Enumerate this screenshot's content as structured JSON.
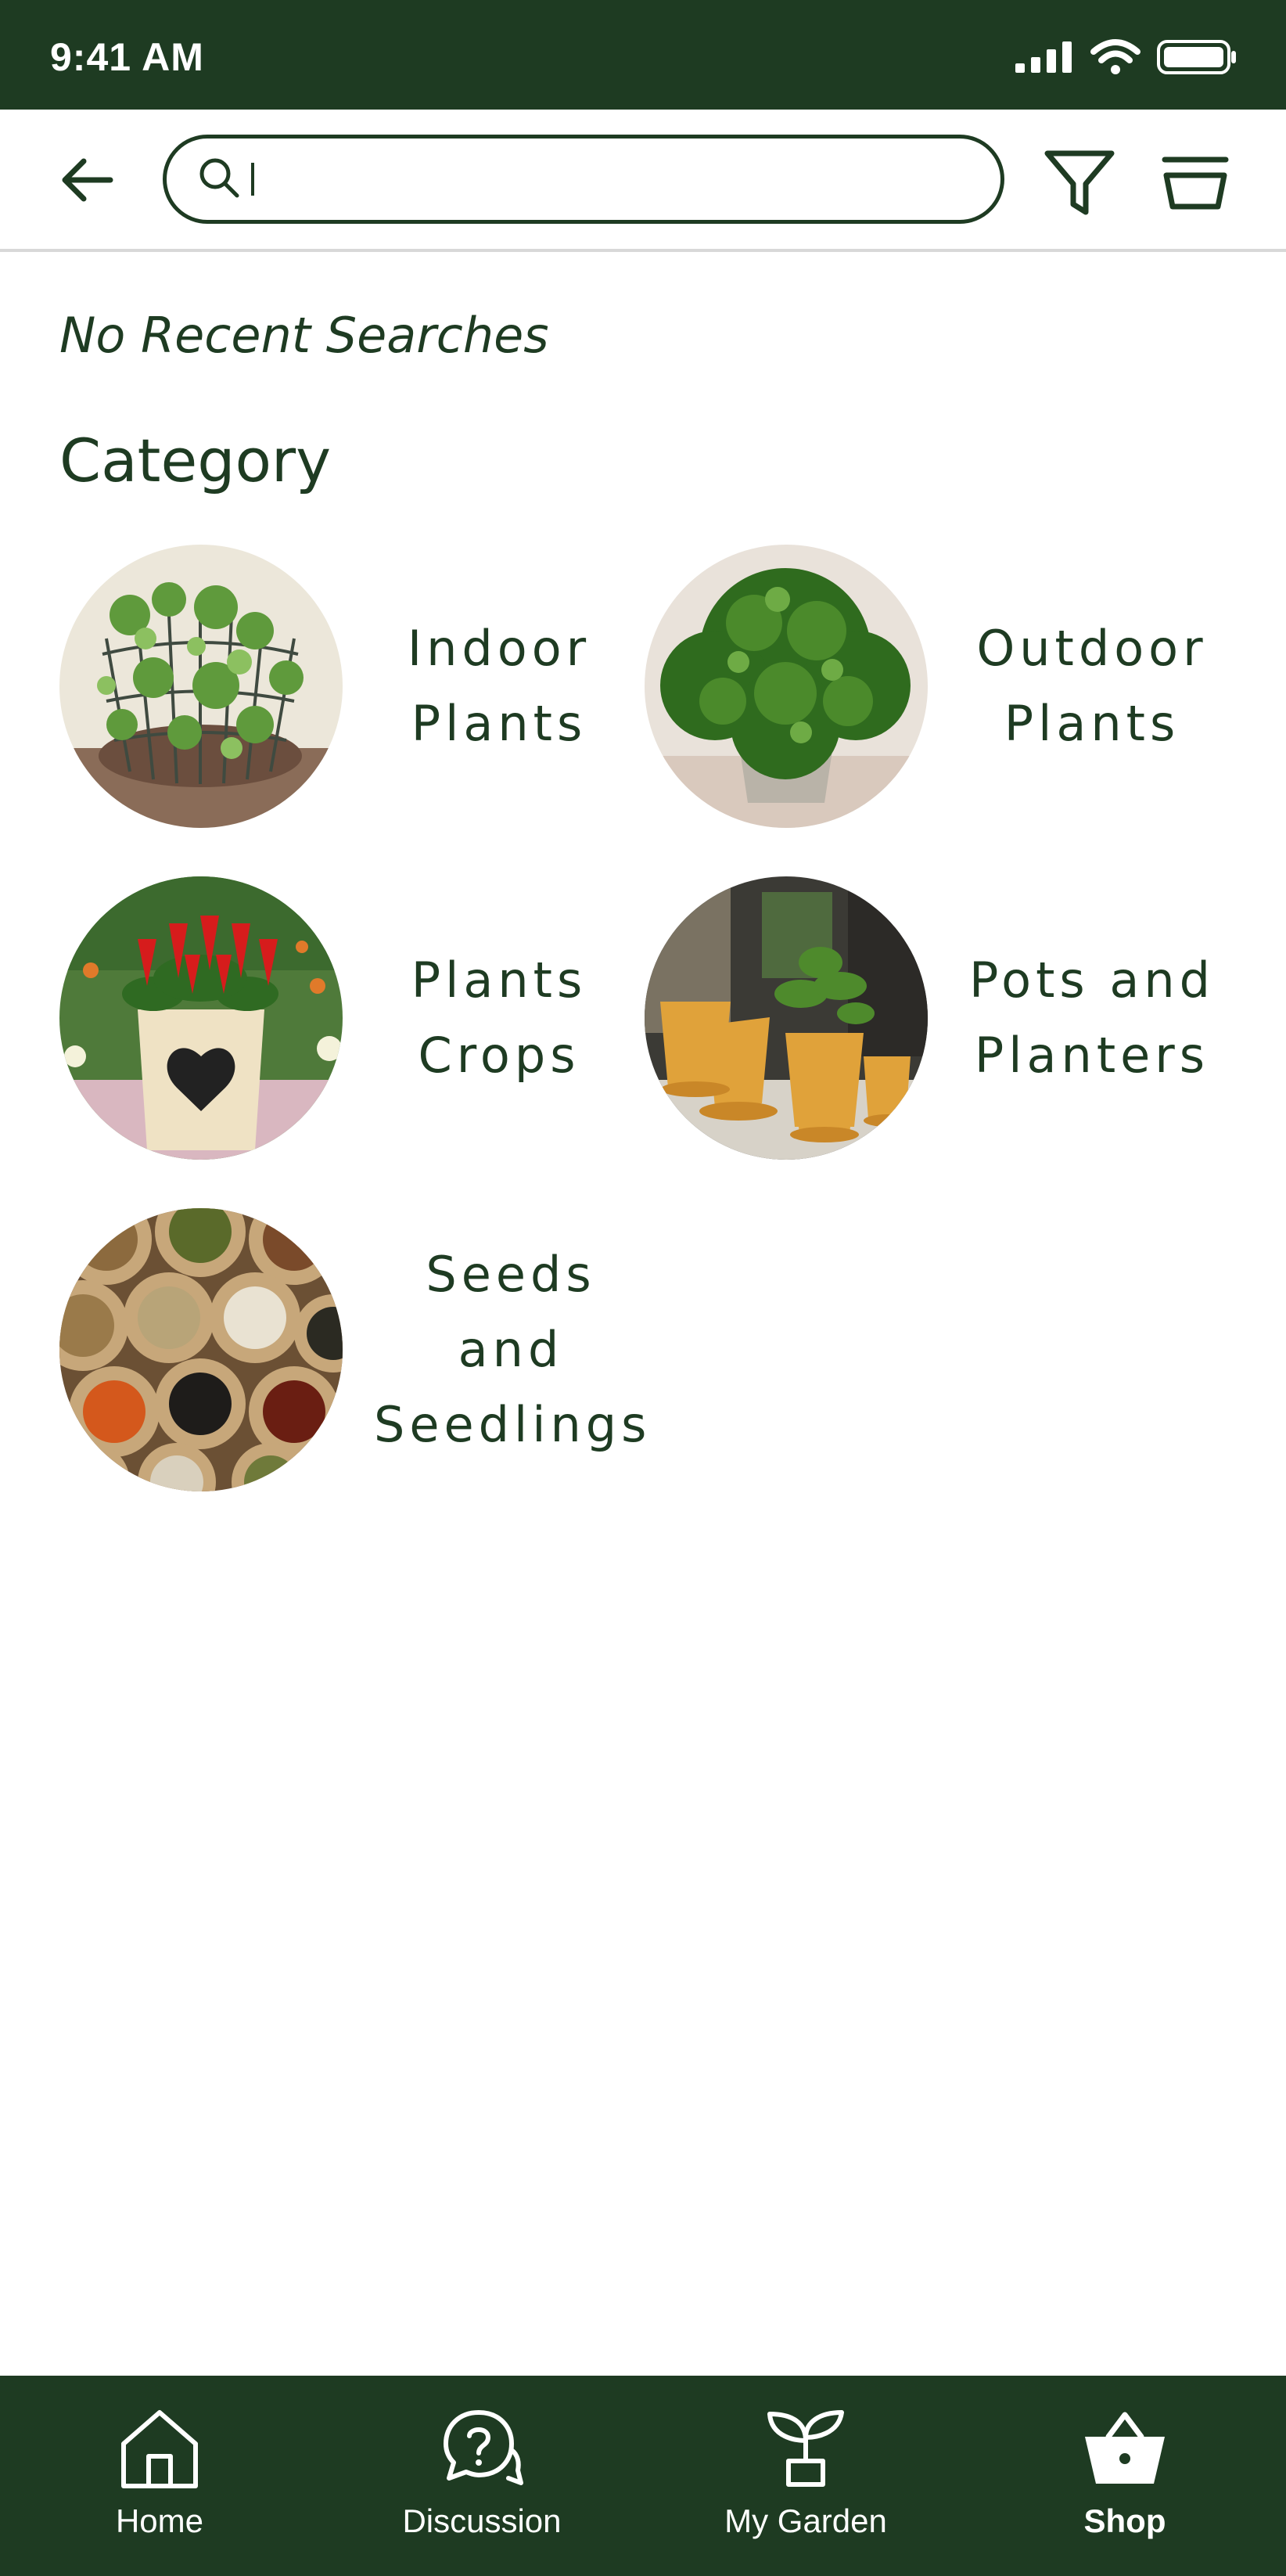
{
  "status_bar": {
    "time": "9:41 AM",
    "icons": [
      "signal-icon",
      "wifi-icon",
      "battery-icon"
    ]
  },
  "header": {
    "back_icon": "arrow-left-icon",
    "search": {
      "value": "",
      "placeholder": "",
      "icon": "search-icon"
    },
    "filter_icon": "filter-icon",
    "basket_icon": "basket-icon"
  },
  "recent": {
    "empty_text": "No Recent Searches"
  },
  "category": {
    "title": "Category",
    "items": [
      {
        "label": "Indoor\nPlants"
      },
      {
        "label": "Outdoor\nPlants"
      },
      {
        "label": "Plants\nCrops"
      },
      {
        "label": "Pots and\nPlanters"
      },
      {
        "label": "Seeds\nand\nSeedlings"
      }
    ]
  },
  "bottom_nav": {
    "items": [
      {
        "label": "Home",
        "icon": "home-icon"
      },
      {
        "label": "Discussion",
        "icon": "discussion-icon"
      },
      {
        "label": "My Garden",
        "icon": "plant-icon"
      },
      {
        "label": "Shop",
        "icon": "shop-basket-icon",
        "active": true
      }
    ]
  },
  "colors": {
    "brand_dark_green": "#1e3b22",
    "background": "#ffffff",
    "divider": "#d8d8d8"
  }
}
